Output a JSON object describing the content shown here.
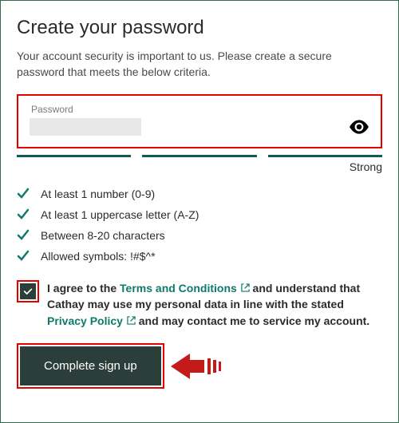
{
  "title": "Create your password",
  "subtitle": "Your account security is important to us. Please create a secure password that meets the below criteria.",
  "password": {
    "label": "Password",
    "value": ""
  },
  "strength": {
    "label": "Strong"
  },
  "criteria": [
    "At least 1 number (0-9)",
    "At least 1 uppercase letter (A-Z)",
    "Between 8-20 characters",
    "Allowed symbols: !#$^*"
  ],
  "consent": {
    "prefix": "I agree to the ",
    "terms_label": "Terms and Conditions",
    "middle": " and understand that Cathay may use my personal data in line with the stated ",
    "privacy_label": "Privacy Policy",
    "suffix": " and may contact me to service my account."
  },
  "submit_label": "Complete sign up",
  "colors": {
    "highlight": "#e60000",
    "brand_dark": "#2c3e3a",
    "link": "#0f7a6b"
  }
}
